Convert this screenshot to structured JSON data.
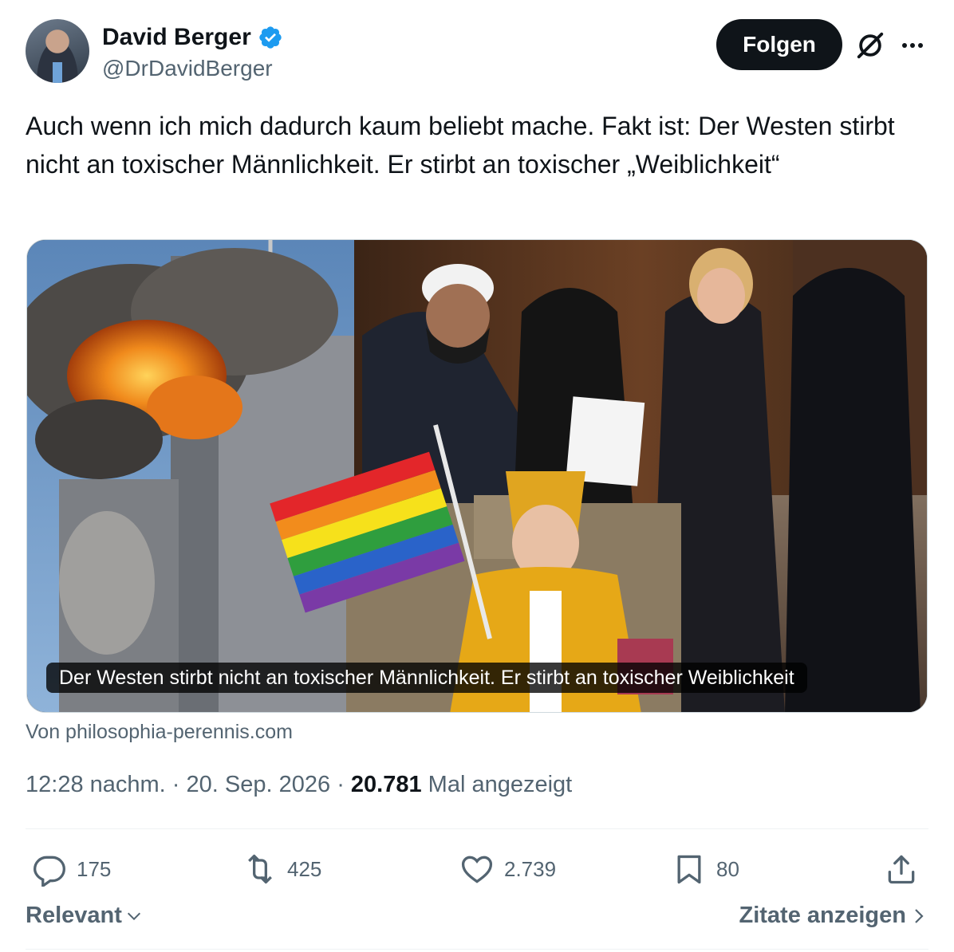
{
  "author": {
    "display_name": "David Berger",
    "handle": "@DrDavidBerger"
  },
  "header": {
    "follow_label": "Folgen"
  },
  "tweet": {
    "text": "Auch wenn ich mich dadurch kaum beliebt mache. Fakt ist: Der Westen stirbt nicht an toxischer Männlichkeit. Er stirbt an toxischer „Weiblichkeit“"
  },
  "media": {
    "caption": "Der Westen stirbt nicht an toxischer Männlichkeit. Er stirbt an toxischer Weiblichkeit",
    "source": "Von philosophia-perennis.com"
  },
  "meta": {
    "time": "12:28 nachm.",
    "date": "20. Sep. 2026",
    "views_count": "20.781",
    "views_label": "Mal angezeigt"
  },
  "actions": {
    "replies": "175",
    "reposts": "425",
    "likes": "2.739",
    "bookmarks": "80"
  },
  "footer": {
    "sort_label": "Relevant",
    "quotes_label": "Zitate anzeigen"
  },
  "colors": {
    "text_primary": "#0f1419",
    "text_secondary": "#536471",
    "verified_blue": "#1d9bf0",
    "follow_bg": "#0f1419",
    "divider": "#eff3f4"
  },
  "icons": {
    "verified": "verified-badge-icon",
    "grok": "grok-icon",
    "more": "more-dots-icon",
    "reply": "reply-icon",
    "repost": "repost-icon",
    "like": "heart-icon",
    "bookmark": "bookmark-icon",
    "share": "share-icon",
    "chevron_down": "chevron-down-icon",
    "chevron_right": "chevron-right-icon"
  }
}
